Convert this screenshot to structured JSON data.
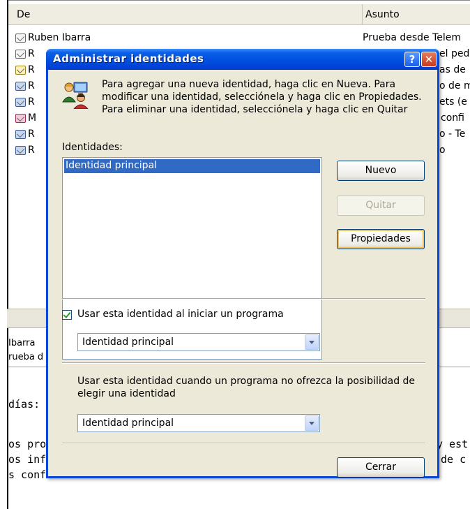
{
  "background": {
    "columns": {
      "from": "De",
      "subject": "Asunto"
    },
    "messages": [
      {
        "from": "Ruben Ibarra",
        "subject": "Prueba desde Telem"
      },
      {
        "from": "R",
        "subject": "el ped"
      },
      {
        "from": "R",
        "subject": "as de"
      },
      {
        "from": "R",
        "subject": "o de m"
      },
      {
        "from": "R",
        "subject": "ets (e"
      },
      {
        "from": "M",
        "subject": "confi"
      },
      {
        "from": "R",
        "subject": "o - Te"
      },
      {
        "from": "R",
        "subject": "o"
      }
    ],
    "preview_header": {
      "from_fragment": "Ibarra",
      "subject_fragment": "rueba d"
    },
    "body_fragments": {
      "greeting": "días:",
      "line1_left": "os pro",
      "line2_left": "os inf",
      "line3_left": "s conf",
      "line1_right": "y est",
      "line2_right": "de c"
    }
  },
  "dialog": {
    "title": "Administrar identidades",
    "help_label": "?",
    "close_label": "✕",
    "intro_text": "Para agregar una nueva identidad, haga clic en Nueva. Para modificar una identidad, selecciónela y haga clic en Propiedades. Para eliminar una identidad, selecciónela y haga clic en Quitar",
    "identities_label": "Identidades:",
    "identities": [
      "Identidad principal"
    ],
    "buttons": {
      "new": "Nuevo",
      "remove": "Quitar",
      "properties": "Propiedades",
      "close": "Cerrar"
    },
    "use_on_start": {
      "label": "Usar esta identidad al iniciar un programa",
      "checked": true,
      "selected": "Identidad principal"
    },
    "use_when_no_choice": {
      "label": "Usar esta identidad cuando un programa no ofrezca la posibilidad de elegir una identidad",
      "selected": "Identidad principal"
    }
  }
}
